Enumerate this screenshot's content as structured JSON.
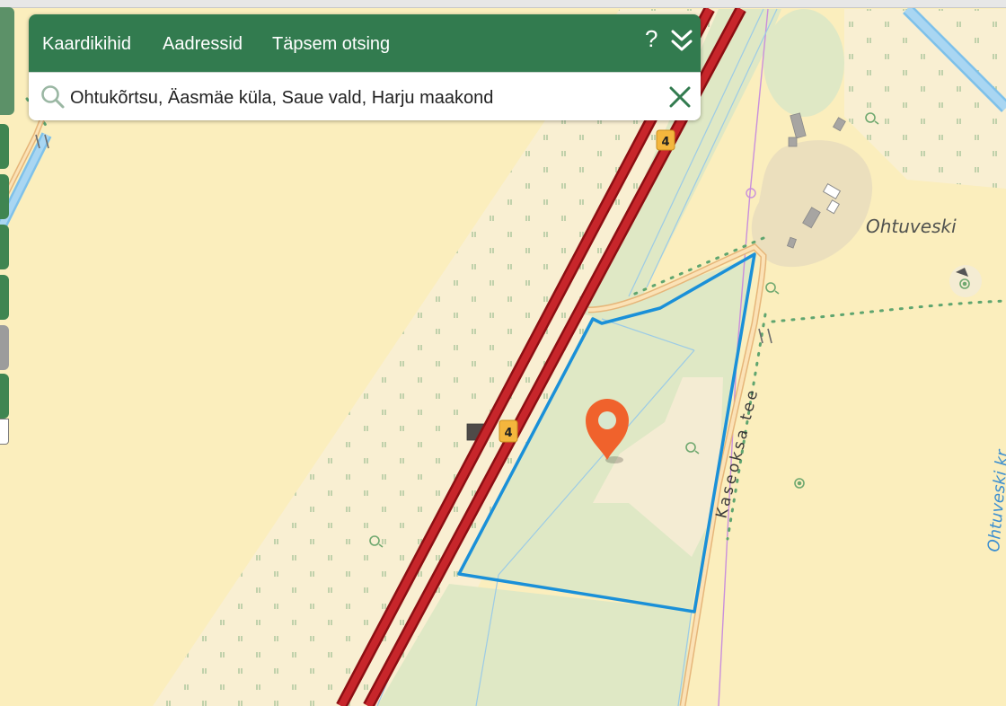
{
  "panel": {
    "tabs": [
      {
        "label": "Kaardikihid"
      },
      {
        "label": "Aadressid"
      },
      {
        "label": "Täpsem otsing"
      }
    ],
    "help_label": "?",
    "search": {
      "value": "Ohtukõrtsu, Äasmäe küla, Saue vald, Harju maakond",
      "placeholder": ""
    }
  },
  "map": {
    "labels": {
      "place": "Ohtuveski",
      "road": "Kaseoksa tee",
      "stream": "Ohtuveski kr",
      "route_number": "4"
    }
  },
  "colors": {
    "panel_green": "#327b4f",
    "map_background": "#fbeebd",
    "parcel_outline": "#1a90d8",
    "highway": "#b5171e",
    "marker": "#f0622c"
  }
}
